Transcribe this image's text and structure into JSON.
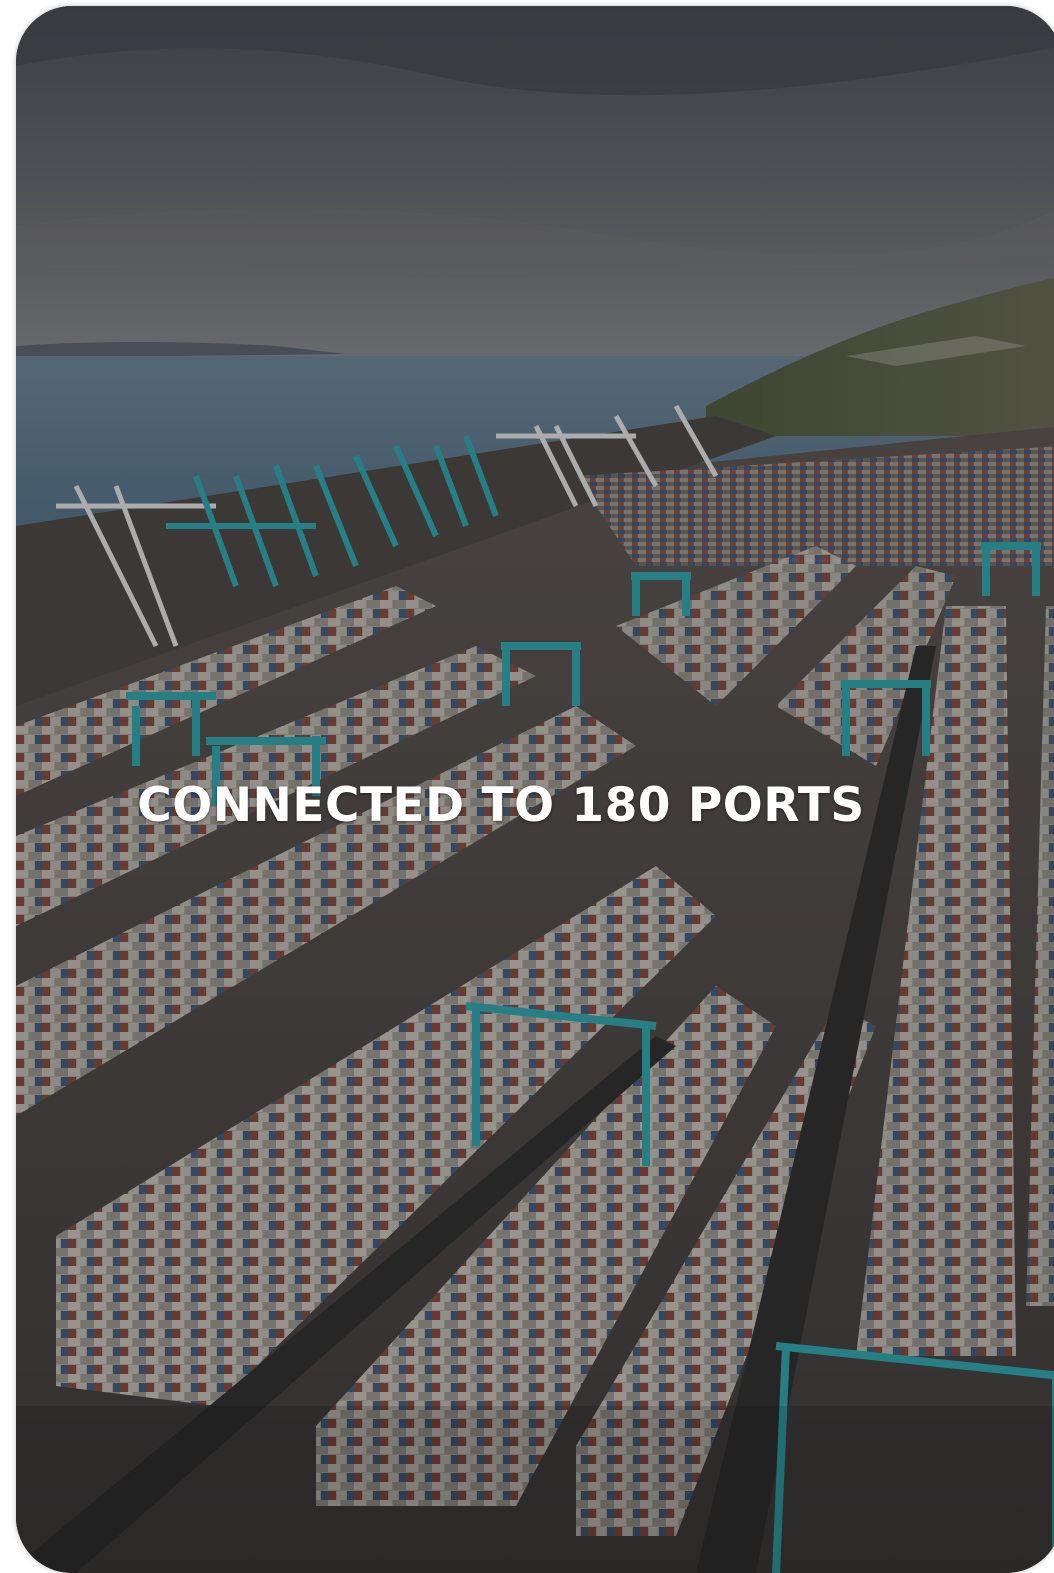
{
  "card": {
    "headline": "CONNECTED TO 180 PORTS",
    "image_subject": "aerial-view-container-port-terminal"
  },
  "colors": {
    "overlay": "#141418",
    "text": "#ffffff",
    "crane_teal": "#2fa8b0",
    "sea": "#4b6a80",
    "sky": "#5a5d66"
  }
}
